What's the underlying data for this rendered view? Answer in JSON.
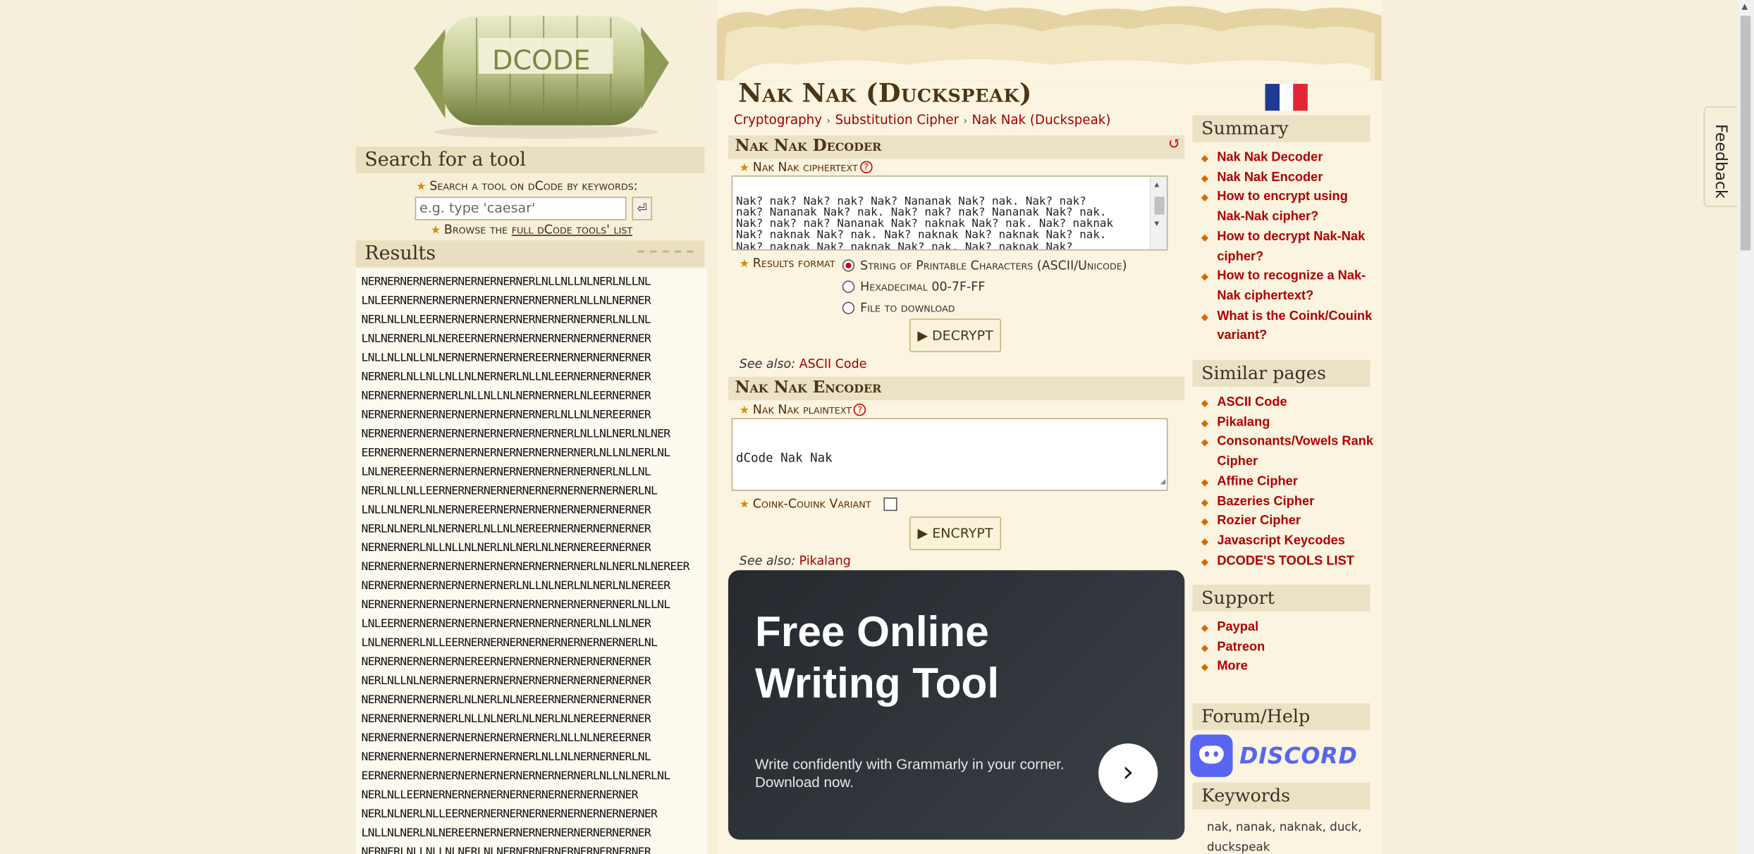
{
  "colors": {
    "brand_red": "#a00000",
    "parchment": "#faf4e0",
    "header_bg": "#ebe2c6",
    "ad_bg": "#2a2f35",
    "discord": "#5865f2"
  },
  "logo": {
    "letters": "DCODE"
  },
  "search": {
    "header": "Search for a tool",
    "label": "Search a tool on dCode by keywords:",
    "placeholder": "e.g. type 'caesar'",
    "submit_icon": "enter-icon",
    "browse_prefix": "Browse the",
    "browse_link": "full dCode tools' list"
  },
  "results": {
    "header": "Results",
    "lines": [
      "NERNERNERNERNERNERNERNERNERLNLLNLLNLNERLNLLNL",
      "LNLEERNERNERNERNERNERNERNERNERNERLNLLNLNERNER",
      "NERLNLLNLEERNERNERNERNERNERNERNERNERNERLNLLNL",
      "LNLNERNERLNLNEREERNERNERNERNERNERNERNERNERNER",
      "LNLLNLLNLLNLNERNERNERNERNEREERNERNERNERNERNER",
      "NERNERLNLLNLLNLLNLNERNERLNLLNLEERNERNERNERNER",
      "NERNERNERNERNERLNLLNLLNLNERNERNERLNLEERNERNER",
      "NERNERNERNERNERNERNERNERNERNERLNLLNLNEREERNER",
      "NERNERNERNERNERNERNERNERNERNERNERLNLLNLNERLNLNER",
      "EERNERNERNERNERNERNERNERNERNERNERNERLNLLNLNERLNL",
      "LNLNEREERNERNERNERNERNERNERNERNERNERNERLNLLNL",
      "NERLNLLNLLEERNERNERNERNERNERNERNERNERNERNERLNL",
      "LNLLNLNERLNLNERNEREERNERNERNERNERNERNERNERNER",
      "NERLNLNERLNLNERNERLNLLNLNEREERNERNERNERNERNER",
      "NERNERNERLNLLNLLNLNERLNLNERLNLNERNEREERNERNER",
      "NERNERNERNERNERNERNERNERNERNERNERNERLNLNERLNLNEREER",
      "NERNERNERNERNERNERNERNERLNLLNLNERLNLNERLNLNEREER",
      "NERNERNERNERNERNERNERNERNERNERNERNERNERNERLNLLNL",
      "LNLEERNERNERNERNERNERNERNERNERNERNERLNLLNLNER",
      "LNLNERNERLNLLEERNERNERNERNERNERNERNERNERNERLNL",
      "NERNERNERNERNERNEREERNERNERNERNERNERNERNERNER",
      "NERLNLLNLNERNERNERNERNERNERNERNERNERNERNERNER",
      "NERNERNERNERNERLNLNERLNLNEREERNERNERNERNERNER",
      "NERNERNERNERNERLNLLNLNERLNLNERLNLNEREERNERNER",
      "NERNERNERNERNERNERNERNERNERNERLNLLNLNEREERNER",
      "NERNERNERNERNERNERNERNERNERLNLLNLNERNERNERLNL",
      "EERNERNERNERNERNERNERNERNERNERNERNERLNLLNLNERLNL",
      "NERLNLLEERNERNERNERNERNERNERNERNERNERNERNER",
      "NERLNLNERLNLLEERNERNERNERNERNERNERNERNERNERNER",
      "LNLLNLNERLNLNEREERNERNERNERNERNERNERNERNERNER",
      "NERNERLNLLNLLNLNERLNLNERNERNERNERNERNERNERNER"
    ]
  },
  "page": {
    "title": "Nak Nak (Duckspeak)",
    "breadcrumb": [
      "Cryptography",
      "Substitution Cipher",
      "Nak Nak (Duckspeak)"
    ],
    "lang_flag": "french-flag-icon"
  },
  "decoder": {
    "header": "Nak Nak Decoder",
    "field_label": "Nak Nak ciphertext",
    "ciphertext": "Nak? nak? Nak? nak? Nak? Nananak Nak? nak. Nak? nak?\nnak? Nananak Nak? nak. Nak? nak? nak? Nananak Nak? nak.\nNak? nak? nak? Nananak Nak? naknak Nak? nak. Nak? naknak\nNak? naknak Nak? nak. Nak? naknak Nak? naknak Nak? nak.\nNak? naknak Nak? naknak Nak? nak. Nak? naknak Nak?\nnaknak Nak? nak. Nak? naknak Nak? nak. Nak? nak? nak?\nNananak Nak? naknak Nak? nak. Nak? naknak",
    "format_label": "Results format",
    "formats": [
      {
        "label": "String of Printable Characters (ASCII/Unicode)",
        "selected": true
      },
      {
        "label": "Hexadecimal 00-7F-FF",
        "selected": false
      },
      {
        "label": "File to download",
        "selected": false
      }
    ],
    "button": "▶ DECRYPT",
    "see_also_label": "See also:",
    "see_also_link": "ASCII Code"
  },
  "encoder": {
    "header": "Nak Nak Encoder",
    "field_label": "Nak Nak plaintext",
    "plaintext": "dCode Nak Nak",
    "variant_label": "Coink-Couink Variant",
    "variant_checked": false,
    "button": "▶ ENCRYPT",
    "see_also_label": "See also:",
    "see_also_link": "Pikalang"
  },
  "ad": {
    "title": "Free Online\nWriting Tool",
    "subtitle": "Write confidently with Grammarly in your corner. Download now.",
    "cta_icon": "chevron-right-icon"
  },
  "summary": {
    "header": "Summary",
    "items": [
      "Nak Nak Decoder",
      "Nak Nak Encoder",
      "How to encrypt using Nak-Nak cipher?",
      "How to decrypt Nak-Nak cipher?",
      "How to recognize a Nak-Nak ciphertext?",
      "What is the Coink/Couink variant?"
    ]
  },
  "similar": {
    "header": "Similar pages",
    "items": [
      "ASCII Code",
      "Pikalang",
      "Consonants/Vowels Rank Cipher",
      "Affine Cipher",
      "Bazeries Cipher",
      "Rozier Cipher",
      "Javascript Keycodes",
      "DCODE'S TOOLS LIST"
    ]
  },
  "support": {
    "header": "Support",
    "items": [
      "Paypal",
      "Patreon",
      "More"
    ]
  },
  "forum": {
    "header": "Forum/Help",
    "discord_label": "DISCORD"
  },
  "keywords": {
    "header": "Keywords",
    "text": "nak, nanak, naknak, duck, duckspeak"
  },
  "feedback_label": "Feedback"
}
